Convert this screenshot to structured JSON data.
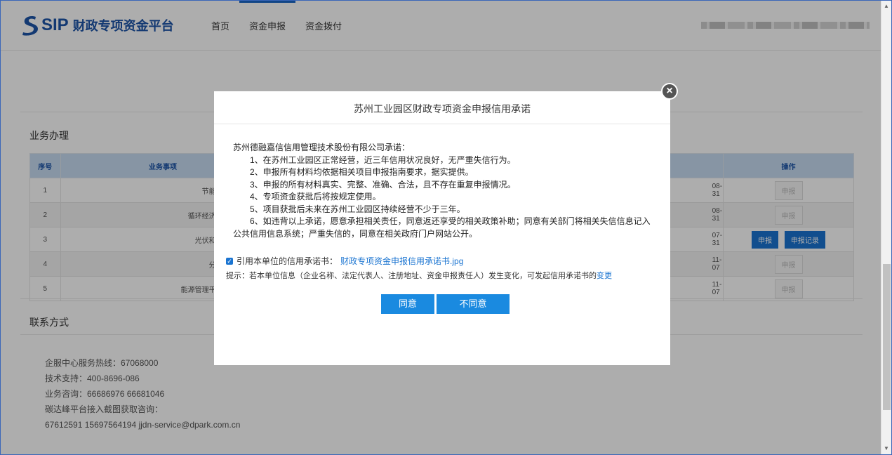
{
  "header": {
    "logo_text": "SIP",
    "platform_name": "财政专项资金平台",
    "nav": [
      "首页",
      "资金申报",
      "资金拨付"
    ],
    "active_nav": 1
  },
  "business": {
    "title": "业务办理",
    "columns": {
      "index": "序号",
      "item": "业务事项",
      "action": "操作"
    },
    "rows": [
      {
        "index": "1",
        "item": "节能改造项目补贴",
        "date": "08-31"
      },
      {
        "index": "2",
        "item": "循环经济发展项目补贴",
        "date": "08-31"
      },
      {
        "index": "3",
        "item": "光伏和储能项目征集",
        "date": "07-31"
      },
      {
        "index": "4",
        "item": "分布式项目补贴",
        "date": "11-07"
      },
      {
        "index": "5",
        "item": "能源管理平台建设项目补",
        "date": "11-07"
      }
    ],
    "apply_label": "申报",
    "record_label": "申报记录"
  },
  "contact": {
    "title": "联系方式",
    "lines": [
      "企服中心服务热线：67068000",
      "技术支持：400-8696-086",
      "业务咨询：66686976 66681046",
      "碳达峰平台接入截图获取咨询：",
      "67612591 15697564194 jjdn-service@dpark.com.cn"
    ]
  },
  "modal": {
    "title": "苏州工业园区财政专项资金申报信用承诺",
    "close_glyph": "×",
    "intro": "苏州德融嘉信信用管理技术股份有限公司承诺：",
    "items": [
      "1、在苏州工业园区正常经营，近三年信用状况良好，无严重失信行为。",
      "2、申报所有材料均依据相关项目申报指南要求，据实提供。",
      "3、申报的所有材料真实、完整、准确、合法，且不存在重复申报情况。",
      "4、专项资金获批后将按规定使用。",
      "5、项目获批后未来在苏州工业园区持续经营不少于三年。",
      "6、如违背以上承诺，愿意承担相关责任，同意返还享受的相关政策补助；同意有关部门将相关失信信息记入"
    ],
    "continuation": "公共信用信息系统；严重失信的，同意在相关政府门户网站公开。",
    "cite_label": "引用本单位的信用承诺书：",
    "cite_file": "财政专项资金申报信用承诺书.jpg",
    "tip_text": "提示：若本单位信息（企业名称、法定代表人、注册地址、资金申报责任人）发生变化，可发起信用承诺书的",
    "tip_link": "变更",
    "agree": "同意",
    "disagree": "不同意"
  }
}
